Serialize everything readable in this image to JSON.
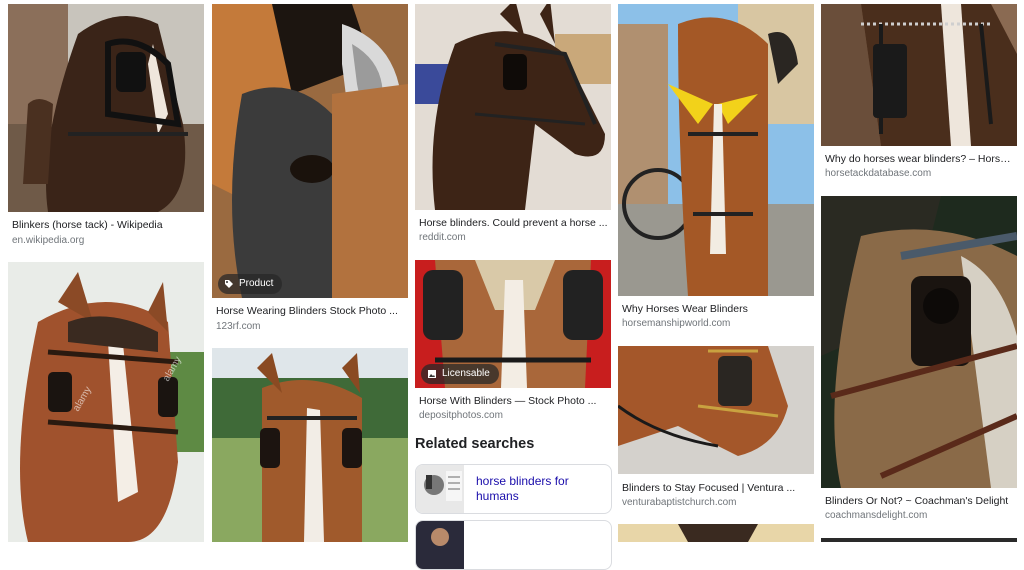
{
  "results": [
    {
      "caption": "Blinkers (horse tack) - Wikipedia",
      "source": "en.wikipedia.org",
      "badge": ""
    },
    {
      "caption": "Horse Wearing Blinders Stock Photo ...",
      "source": "123rf.com",
      "badge": "Product"
    },
    {
      "caption": "Horse blinders. Could prevent a horse ...",
      "source": "reddit.com",
      "badge": ""
    },
    {
      "caption": "Why Horses Wear Blinders",
      "source": "horsemanshipworld.com",
      "badge": ""
    },
    {
      "caption": "Why do horses wear blinders? – Horse ...",
      "source": "horsetackdatabase.com",
      "badge": ""
    },
    {
      "caption": "Horse With Blinders — Stock Photo ...",
      "source": "depositphotos.com",
      "badge": "Licensable"
    },
    {
      "caption": "Blinders to Stay Focused | Ventura ...",
      "source": "venturabaptistchurch.com",
      "badge": ""
    },
    {
      "caption": "Blinders Or Not? ~ Coachman's Delight",
      "source": "coachmansdelight.com",
      "badge": ""
    }
  ],
  "related": {
    "title": "Related searches",
    "items": [
      {
        "label": "horse blinders for humans"
      },
      {
        "label": ""
      }
    ]
  },
  "watermarks": {
    "alamy": "alamy"
  },
  "icons": {
    "product": "tag-icon",
    "licensable": "image-icon"
  }
}
